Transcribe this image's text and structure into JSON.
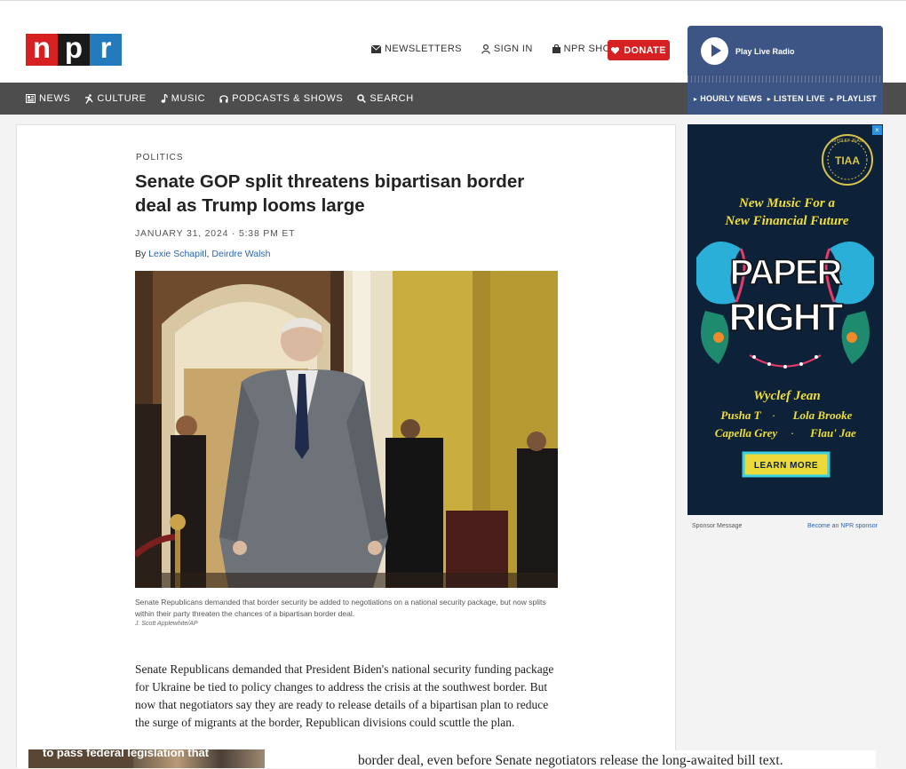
{
  "brand": {
    "letters": [
      "n",
      "p",
      "r"
    ],
    "colors": [
      "#d62021",
      "#1a1a1a",
      "#237bbd"
    ]
  },
  "header": {
    "links": [
      {
        "label": "NEWSLETTERS",
        "icon": "envelope-icon"
      },
      {
        "label": "SIGN IN",
        "icon": "user-icon"
      },
      {
        "label": "NPR SHOP",
        "icon": "shopping-bag-icon"
      }
    ],
    "donate_label": "DONATE",
    "player_label": "Play Live Radio"
  },
  "nav": {
    "items": [
      {
        "label": "NEWS",
        "icon": "news-icon"
      },
      {
        "label": "CULTURE",
        "icon": "culture-icon"
      },
      {
        "label": "MUSIC",
        "icon": "music-note-icon"
      },
      {
        "label": "PODCASTS & SHOWS",
        "icon": "headphones-icon"
      },
      {
        "label": "SEARCH",
        "icon": "search-icon"
      }
    ],
    "radio_links": [
      "HOURLY NEWS",
      "LISTEN LIVE",
      "PLAYLIST"
    ]
  },
  "article": {
    "kicker": "POLITICS",
    "headline": "Senate GOP split threatens bipartisan border deal as Trump looms large",
    "date": "JANUARY 31, 2024 · 5:38 PM ET",
    "by_prefix": "By ",
    "authors": [
      "Lexie Schapitl",
      "Deirdre Walsh"
    ],
    "author_sep": ", ",
    "caption": "Senate Republicans demanded that border security be added to negotiations on a national security package, but now splits within their party threaten the chances of a bipartisan border deal.",
    "credit": "J. Scott Applewhite/AP",
    "body": "Senate Republicans demanded that President Biden's national security funding package for Ukraine be tied to policy changes to address the crisis at the southwest border. But now that negotiators say they are ready to release details of a bipartisan plan to reduce the surge of migrants at the border, Republican divisions could scuttle the plan."
  },
  "sponsor": {
    "ad_lines": [
      "TIAA",
      "WYCLEF JEAN",
      "New Music For a",
      "New Financial Future",
      "PAPER",
      "RIGHT",
      "Wyclef Jean",
      "Pusha T",
      "Lola Brooke",
      "Capella Grey",
      "Flau' Jae",
      "LEARN MORE"
    ],
    "label": "Sponsor Message",
    "become_label": "Become an NPR sponsor"
  },
  "below_fold": {
    "promo_text": "to pass federal legislation that",
    "body_text": "border deal, even before Senate negotiators release the long-awaited bill text."
  }
}
